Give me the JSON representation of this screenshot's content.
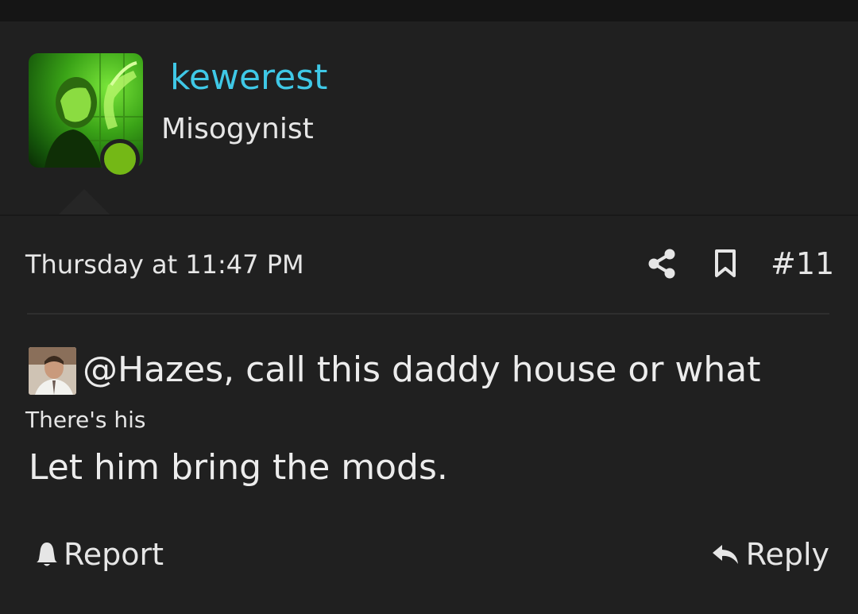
{
  "author": {
    "username": "kewerest",
    "user_title": "Misogynist",
    "status": "online",
    "avatar_icon": "user-avatar"
  },
  "post": {
    "timestamp": "Thursday at 11:47 PM",
    "number": "#11",
    "mention_text": "@Hazes, call this daddy house or what",
    "subtext": "There's his",
    "message": "Let him bring the mods."
  },
  "actions": {
    "share_icon": "share-icon",
    "bookmark_icon": "bookmark-icon",
    "report_label": "Report",
    "reply_label": "Reply"
  },
  "colors": {
    "background": "#202020",
    "username": "#3fc8e6",
    "online": "#74b816",
    "text": "#e6e6e6"
  }
}
